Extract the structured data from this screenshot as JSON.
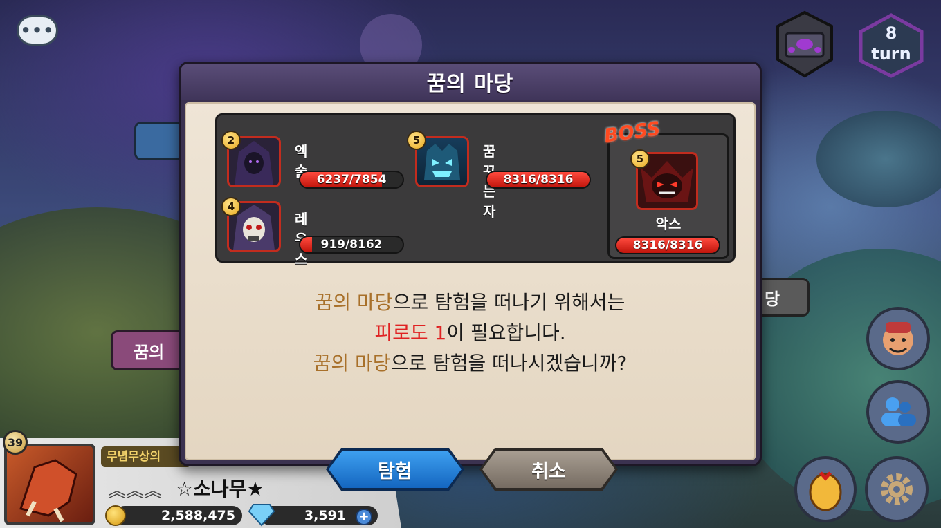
{
  "dialog": {
    "title": "꿈의 마당",
    "monsters": [
      {
        "level": "2",
        "name": "엑술",
        "hp_text": "6237/7854",
        "hp_fraction": 0.794
      },
      {
        "level": "5",
        "name": "꿈꾸는자",
        "hp_text": "8316/8316",
        "hp_fraction": 1.0
      },
      {
        "level": "4",
        "name": "레우스",
        "hp_text": "919/8162",
        "hp_fraction": 0.113
      }
    ],
    "boss": {
      "tag": "BOSS",
      "level": "5",
      "name": "악스",
      "hp_text": "8316/8316",
      "hp_fraction": 1.0
    },
    "message": {
      "line1_highlight": "꿈의 마당",
      "line1_rest": "으로 탐험을 떠나기 위해서는",
      "line2_highlight": "피로도 1",
      "line2_rest": "이 필요합니다.",
      "line3_highlight": "꿈의 마당",
      "line3_rest": "으로 탐험을 떠나시겠습니까?"
    },
    "confirm_label": "탐험",
    "cancel_label": "취소"
  },
  "hud": {
    "turn_count": "8",
    "turn_label": "turn",
    "left_stage_label": "꿈의",
    "right_stage_label": "당"
  },
  "player": {
    "level": "39",
    "title": "무념무상의",
    "name": "☆소나무★",
    "gold": "2,588,475",
    "gems": "3,591",
    "add_gems": "+"
  },
  "colors": {
    "dialog_frame": "#3b3250",
    "confirm_button": "#1e73c8",
    "cancel_button": "#8a827a",
    "highlight_brown": "#a8702a",
    "highlight_red": "#e02222",
    "hp_red": "#e0261a"
  },
  "icons": [
    "chat-icon",
    "treasure-chest-icon",
    "turn-dice-icon",
    "heroes-icon",
    "friends-icon",
    "egg-gift-icon",
    "gear-icon",
    "gold-coin-icon",
    "gem-icon",
    "plus-icon"
  ]
}
